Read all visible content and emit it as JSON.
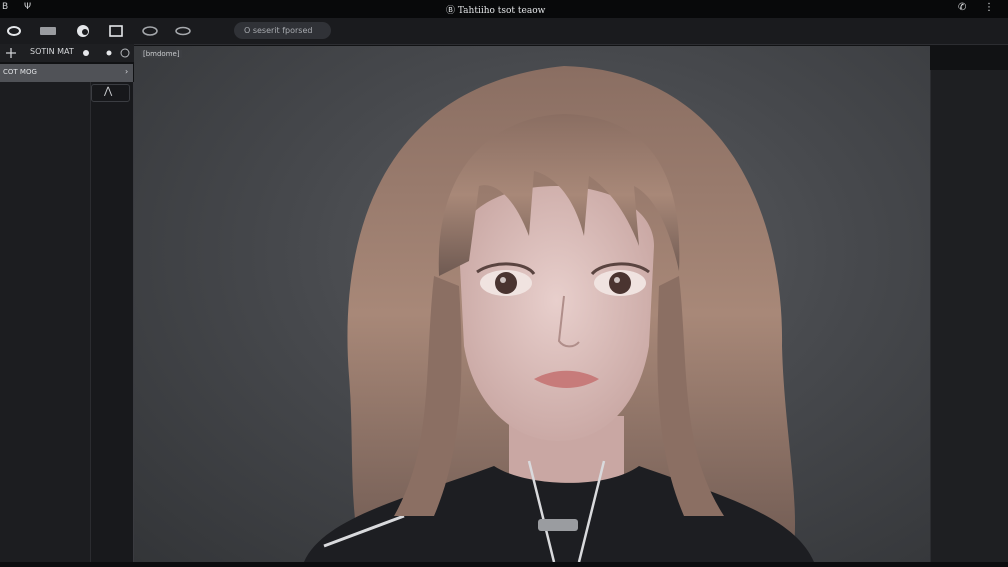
{
  "titlebar": {
    "left_icon_1": "B",
    "left_icon_2": "Ψ",
    "title": "Ⓑ Tahtiiho tsot teaow",
    "right_icon_1": "✆",
    "right_icon_2": "⋮"
  },
  "toolbar": {
    "tools": [
      "eye-tool-icon",
      "layer-tool-icon",
      "brush-tool-icon",
      "rect-tool-icon",
      "ellipse-tool-icon",
      "lasso-tool-icon"
    ],
    "search_text": "O seserit fporsed"
  },
  "left_panel": {
    "header_label": "SOTIN MAT",
    "title": "COT MOG",
    "title_arrow": "›",
    "collapse_glyph": "⋀"
  },
  "canvas": {
    "tag": "[bmdome]",
    "image_alt": "portrait-render"
  }
}
